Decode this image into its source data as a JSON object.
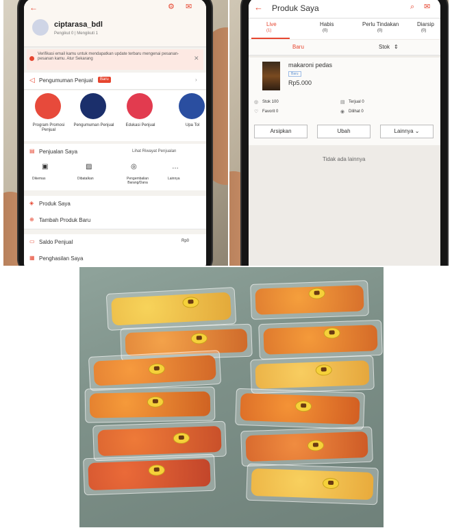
{
  "left_phone": {
    "username": "ciptarasa_bdl",
    "followers": "Pengikut 0 | Mengikuti 1",
    "verify_notice": "Verifikasi email kamu untuk mendapatkan update terbaru mengenai pesanan-pesanan kamu. Atur Sekarang",
    "announcement": "Pengumuman Penjual",
    "new_badge": "Baru",
    "tiles": [
      "Program Promosi Penjual",
      "Pengumuman Penjual",
      "Edukasi Penjual",
      "Upa Tol"
    ],
    "sales_title": "Penjualan Saya",
    "sales_history": "Lihat Riwayat Penjualan",
    "sales_items": [
      "Dikemas",
      "Dibatalkan",
      "Pengembalian Barang/Dana",
      "Lainnya"
    ],
    "menu": [
      "Produk Saya",
      "Tambah Produk Baru",
      "Saldo Penjual",
      "Penghasilan Saya"
    ],
    "saldo_value": "Rp0"
  },
  "right_phone": {
    "title": "Produk Saya",
    "tabs": [
      {
        "label": "Live",
        "count": "(1)"
      },
      {
        "label": "Habis",
        "count": "(0)"
      },
      {
        "label": "Perlu Tindakan",
        "count": "(0)"
      },
      {
        "label": "Diarsip",
        "count": "(0)"
      }
    ],
    "sub_tabs": [
      "Baru",
      "Stok"
    ],
    "product_name": "makaroni pedas",
    "product_tag": "Baru",
    "price": "Rp5.000",
    "stats": {
      "stock": "Stok 100",
      "sold": "Terjual 0",
      "favorite": "Favorit 0",
      "seen": "Dilihat 0"
    },
    "buttons": [
      "Arsipkan",
      "Ubah",
      "Lainnya"
    ],
    "footer": "Tidak ada lainnya"
  }
}
